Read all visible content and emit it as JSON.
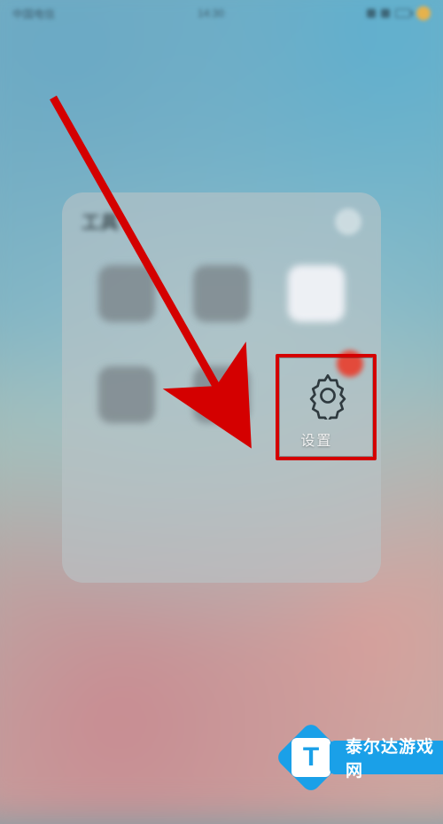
{
  "statusbar": {
    "carrier": "中国电信",
    "time": "14:30"
  },
  "folder": {
    "title": "工具",
    "settings_label": "设置"
  },
  "watermark": {
    "letter": "T",
    "text": "泰尔达游戏网"
  }
}
